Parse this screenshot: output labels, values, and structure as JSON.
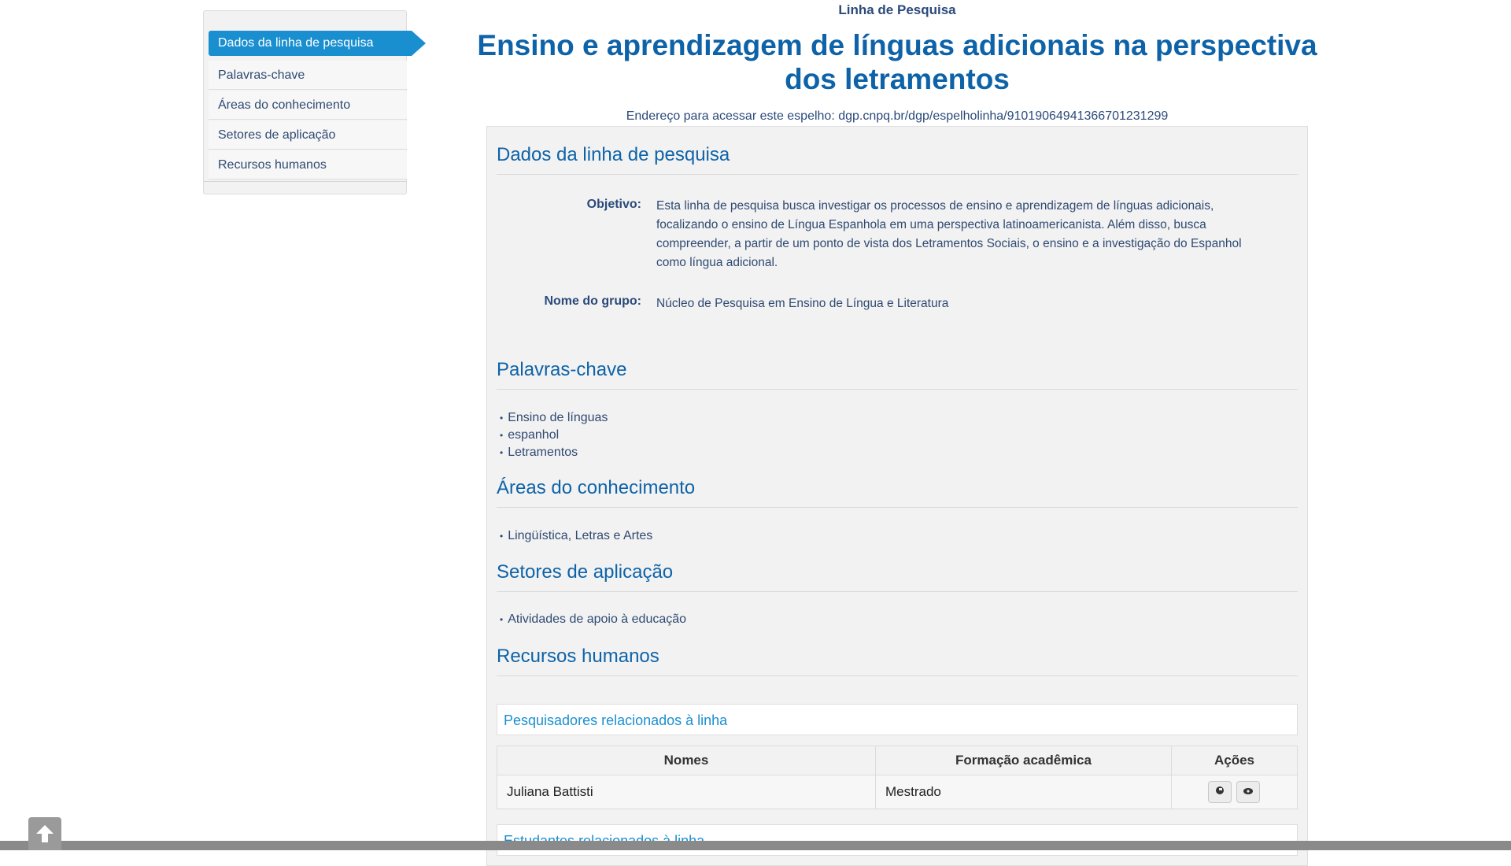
{
  "sidebar": {
    "items": [
      {
        "label": "Dados da linha de pesquisa"
      },
      {
        "label": "Palavras-chave"
      },
      {
        "label": "Áreas do conhecimento"
      },
      {
        "label": "Setores de aplicação"
      },
      {
        "label": "Recursos humanos"
      }
    ]
  },
  "header": {
    "kicker": "Linha de Pesquisa",
    "title": "Ensino e aprendizagem de línguas adicionais na perspectiva dos letramentos",
    "address": "Endereço para acessar este espelho: dgp.cnpq.br/dgp/espelholinha/9101906494136670123​1299"
  },
  "dados": {
    "section_title": "Dados da linha de pesquisa",
    "objetivo_label": "Objetivo:",
    "objetivo_text": "Esta linha de pesquisa busca investigar os processos de ensino e aprendizagem de línguas adicionais, focalizando o ensino de Língua Espanhola em uma perspectiva latinoamericanista. Além disso, busca compreender, a partir de um ponto de vista dos Letramentos Sociais, o ensino e a investigação do Espanhol como língua adicional.",
    "grupo_label": "Nome do grupo:",
    "grupo_value": "Núcleo de Pesquisa em Ensino de Língua e Literatura"
  },
  "palavras": {
    "section_title": "Palavras-chave",
    "items": [
      "Ensino de línguas",
      "espanhol",
      "Letramentos"
    ]
  },
  "areas": {
    "section_title": "Áreas do conhecimento",
    "items": [
      "Lingüística, Letras e Artes"
    ]
  },
  "setores": {
    "section_title": "Setores de aplicação",
    "items": [
      "Atividades de apoio à educação"
    ]
  },
  "recursos": {
    "section_title": "Recursos humanos",
    "pesquisadores_title": "Pesquisadores relacionados à linha",
    "table": {
      "headers": [
        "Nomes",
        "Formação acadêmica",
        "Ações"
      ],
      "rows": [
        {
          "nome": "Juliana Battisti",
          "formacao": "Mestrado"
        }
      ]
    },
    "estudantes_title": "Estudantes relacionados à linha"
  },
  "icons": {
    "curriculo": "curriculum-icon",
    "view": "eye-icon",
    "back_to_top": "arrow-up-icon"
  },
  "colors": {
    "accent": "#1a8fd0",
    "title": "#0e63a8"
  }
}
